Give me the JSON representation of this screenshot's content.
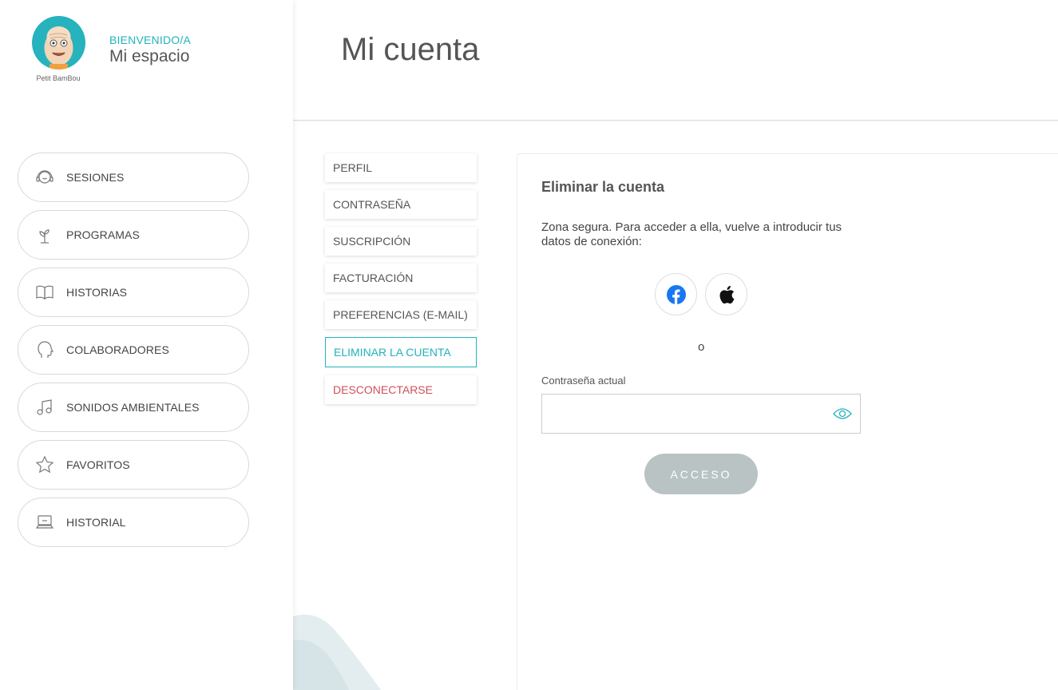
{
  "brand": {
    "name": "Petit BamBou"
  },
  "welcome": {
    "small": "BIENVENIDO/A",
    "big": "Mi espacio"
  },
  "nav": {
    "items": [
      {
        "label": "SESIONES",
        "icon": "headphones-icon"
      },
      {
        "label": "PROGRAMAS",
        "icon": "sprout-icon"
      },
      {
        "label": "HISTORIAS",
        "icon": "book-icon"
      },
      {
        "label": "COLABORADORES",
        "icon": "profile-head-icon"
      },
      {
        "label": "SONIDOS AMBIENTALES",
        "icon": "music-note-icon"
      },
      {
        "label": "FAVORITOS",
        "icon": "star-icon"
      },
      {
        "label": "HISTORIAL",
        "icon": "laptop-icon"
      }
    ]
  },
  "header": {
    "title": "Mi cuenta"
  },
  "submenu": {
    "items": [
      {
        "label": "PERFIL"
      },
      {
        "label": "CONTRASEÑA"
      },
      {
        "label": "SUSCRIPCIÓN"
      },
      {
        "label": "FACTURACIÓN"
      },
      {
        "label": "PREFERENCIAS (E-MAIL)"
      },
      {
        "label": "ELIMINAR LA CUENTA"
      },
      {
        "label": "DESCONECTARSE"
      }
    ]
  },
  "card": {
    "title": "Eliminar la cuenta",
    "description": "Zona segura. Para acceder a ella, vuelve a introducir tus datos de conexión:",
    "or_text": "o",
    "password_label": "Contraseña actual",
    "password_value": "",
    "submit_label": "ACCESO"
  },
  "colors": {
    "accent": "#21b3bb",
    "danger": "#d0505a",
    "button_disabled": "#b9c3c4",
    "facebook": "#1877f2"
  }
}
